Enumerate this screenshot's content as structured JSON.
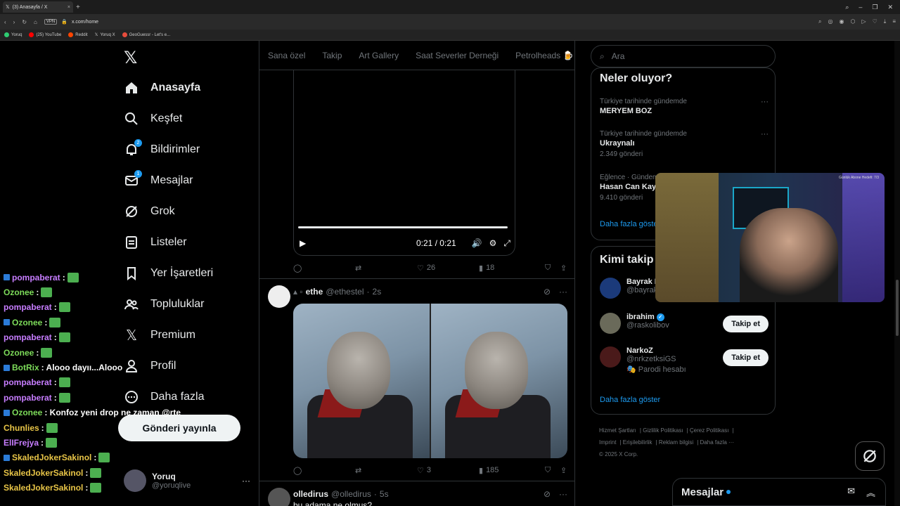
{
  "browser": {
    "tab_title": "(3) Anasayfa / X",
    "url": "x.com/home",
    "vpn": "VPN",
    "bookmarks": [
      {
        "label": "Yoruq",
        "color": "#2ecc71"
      },
      {
        "label": "(25) YouTube",
        "color": "#ff0000"
      },
      {
        "label": "Reddit",
        "color": "#ff4500"
      },
      {
        "label": "Yoruq X",
        "color": "#ffffff"
      },
      {
        "label": "GeoGuessr - Let's e...",
        "color": "#e74c3c"
      }
    ]
  },
  "nav": {
    "items": [
      {
        "label": "Anasayfa",
        "icon": "home-icon"
      },
      {
        "label": "Keşfet",
        "icon": "search-icon"
      },
      {
        "label": "Bildirimler",
        "icon": "bell-icon",
        "badge": "2"
      },
      {
        "label": "Mesajlar",
        "icon": "mail-icon",
        "badge": "1"
      },
      {
        "label": "Grok",
        "icon": "grok-icon"
      },
      {
        "label": "Listeler",
        "icon": "list-icon"
      },
      {
        "label": "Yer İşaretleri",
        "icon": "bookmark-icon"
      },
      {
        "label": "Topluluklar",
        "icon": "communities-icon"
      },
      {
        "label": "Premium",
        "icon": "x-icon"
      },
      {
        "label": "Profil",
        "icon": "profile-icon"
      },
      {
        "label": "Daha fazla",
        "icon": "more-icon"
      }
    ],
    "post_button": "Gönderi yayınla",
    "account": {
      "name": "Yoruq",
      "handle": "@yoruqlive"
    }
  },
  "chat": [
    {
      "user": "pompaberat",
      "color": "#c77dff",
      "msg": ":",
      "emote": true
    },
    {
      "user": "Ozonee",
      "color": "#7ddc5a",
      "msg": ":",
      "emote": true
    },
    {
      "user": "pompaberat",
      "color": "#c77dff",
      "msg": ":",
      "emote": true
    },
    {
      "user": "Ozonee",
      "color": "#7ddc5a",
      "msg": ":",
      "emote": true
    },
    {
      "user": "pompaberat",
      "color": "#c77dff",
      "msg": ":",
      "emote": true
    },
    {
      "user": "Ozonee",
      "color": "#7ddc5a",
      "msg": ":",
      "emote": true
    },
    {
      "user": "BotRix",
      "color": "#7ddc5a",
      "msg": ": Alooo dayıı...Alooo",
      "emote": false
    },
    {
      "user": "pompaberat",
      "color": "#c77dff",
      "msg": ":",
      "emote": true
    },
    {
      "user": "pompaberat",
      "color": "#c77dff",
      "msg": ":",
      "emote": true
    },
    {
      "user": "Ozonee",
      "color": "#7ddc5a",
      "msg": ": Konfoz yeni drop ne zaman @rte",
      "emote": false
    },
    {
      "user": "Chunlies",
      "color": "#e8c547",
      "msg": ":",
      "emote": true
    },
    {
      "user": "ElIFrejya",
      "color": "#c77dff",
      "msg": ":",
      "emote": true
    },
    {
      "user": "SkaledJokerSakinol",
      "color": "#e8c547",
      "msg": ":",
      "emote": true
    },
    {
      "user": "SkaledJokerSakinol",
      "color": "#e8c547",
      "msg": ":",
      "emote": true
    },
    {
      "user": "SkaledJokerSakinol",
      "color": "#e8c547",
      "msg": ":",
      "emote": true
    }
  ],
  "feed": {
    "tabs": [
      "Sana özel",
      "Takip",
      "Art Gallery",
      "Saat Severler Derneği",
      "Petrolheads"
    ],
    "video": {
      "time": "0:21 / 0:21",
      "progress": 1.0
    },
    "post1_stats": {
      "likes": "26",
      "views": "18"
    },
    "post2": {
      "name": "ethe",
      "handle": "@ethestel",
      "time": "2s",
      "likes": "3",
      "views": "185"
    },
    "post3": {
      "name": "olledirus",
      "handle": "@olledirus",
      "time": "5s",
      "text": "bu adama ne olmuş?"
    }
  },
  "right": {
    "search_placeholder": "Ara",
    "trends_title": "Neler oluyor?",
    "trends": [
      {
        "context": "Türkiye tarihinde gündemde",
        "topic": "MERYEM BOZ",
        "count": ""
      },
      {
        "context": "Türkiye tarihinde gündemde",
        "topic": "Ukraynalı",
        "count": "2.349 gönderi"
      },
      {
        "context": "Eğlence · Gündemde",
        "topic": "Hasan Can Kaya",
        "count": "9.410 gönderi"
      }
    ],
    "show_more": "Daha fazla göster",
    "who_title": "Kimi takip et",
    "who": [
      {
        "name": "Bayrak N",
        "handle": "@bayrak...",
        "extra": "",
        "button": ""
      },
      {
        "name": "ibrahim",
        "handle": "@raskolibov",
        "extra": "",
        "button": "Takip et",
        "verified": true
      },
      {
        "name": "NarkoZ",
        "handle": "@nrkzetksiGS",
        "extra": "Parodi hesabı",
        "button": "Takip et"
      }
    ],
    "who_show_more": "Daha fazla göster",
    "footer": [
      "Hizmet Şartları",
      "Gizlilik Politikası",
      "Çerez Politikası",
      "Imprint",
      "Erişilebilirlik",
      "Reklam bilgisi",
      "Daha fazla ···",
      "© 2025 X Corp."
    ]
  },
  "webcam": {
    "caption": "Günlük Abone Hedefi: 7/3"
  },
  "messages_drawer": {
    "title": "Mesajlar"
  }
}
